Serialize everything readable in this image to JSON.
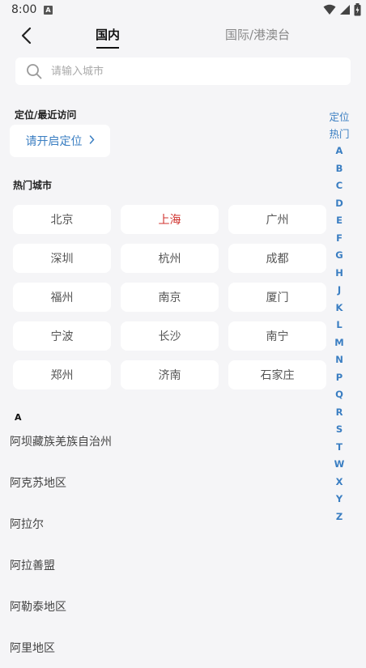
{
  "status": {
    "time": "8:00",
    "notif_glyph": "A"
  },
  "header": {
    "tab_domestic": "国内",
    "tab_international": "国际/港澳台"
  },
  "search": {
    "placeholder": "请输入城市"
  },
  "location": {
    "section_title": "定位/最近访问",
    "locate_button": "请开启定位"
  },
  "hot": {
    "section_title": "热门城市",
    "cities": [
      "北京",
      "上海",
      "广州",
      "深圳",
      "杭州",
      "成都",
      "福州",
      "南京",
      "厦门",
      "宁波",
      "长沙",
      "南宁",
      "郑州",
      "济南",
      "石家庄"
    ],
    "selected": "上海"
  },
  "groups": [
    {
      "letter": "A",
      "cities": [
        "阿坝藏族羌族自治州",
        "阿克苏地区",
        "阿拉尔",
        "阿拉善盟",
        "阿勒泰地区",
        "阿里地区"
      ]
    }
  ],
  "index_bar": [
    "定位",
    "热门",
    "A",
    "B",
    "C",
    "D",
    "E",
    "F",
    "G",
    "H",
    "J",
    "K",
    "L",
    "M",
    "N",
    "P",
    "Q",
    "R",
    "S",
    "T",
    "W",
    "X",
    "Y",
    "Z"
  ],
  "colors": {
    "accent": "#3a7ec2",
    "selected": "#d0312d",
    "background": "#f5f5f7"
  }
}
